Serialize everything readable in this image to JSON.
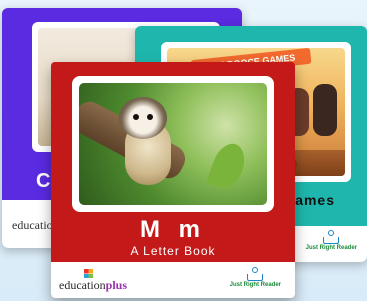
{
  "books": {
    "purple": {
      "title_fragment": "Cl",
      "brand_fragment": "education",
      "color": "#5a2be0"
    },
    "teal": {
      "title_fragment": "ames",
      "banner_text": "THE BOOCE GAMES",
      "brand_label": "Just Right Reader",
      "color": "#1fb7ad"
    },
    "red": {
      "title": "M m",
      "subtitle": "A Letter Book",
      "brand_label": "Just Right Reader",
      "color": "#c41919"
    }
  },
  "logos": {
    "education_plus": {
      "prefix": "education",
      "suffix": "plus"
    }
  }
}
